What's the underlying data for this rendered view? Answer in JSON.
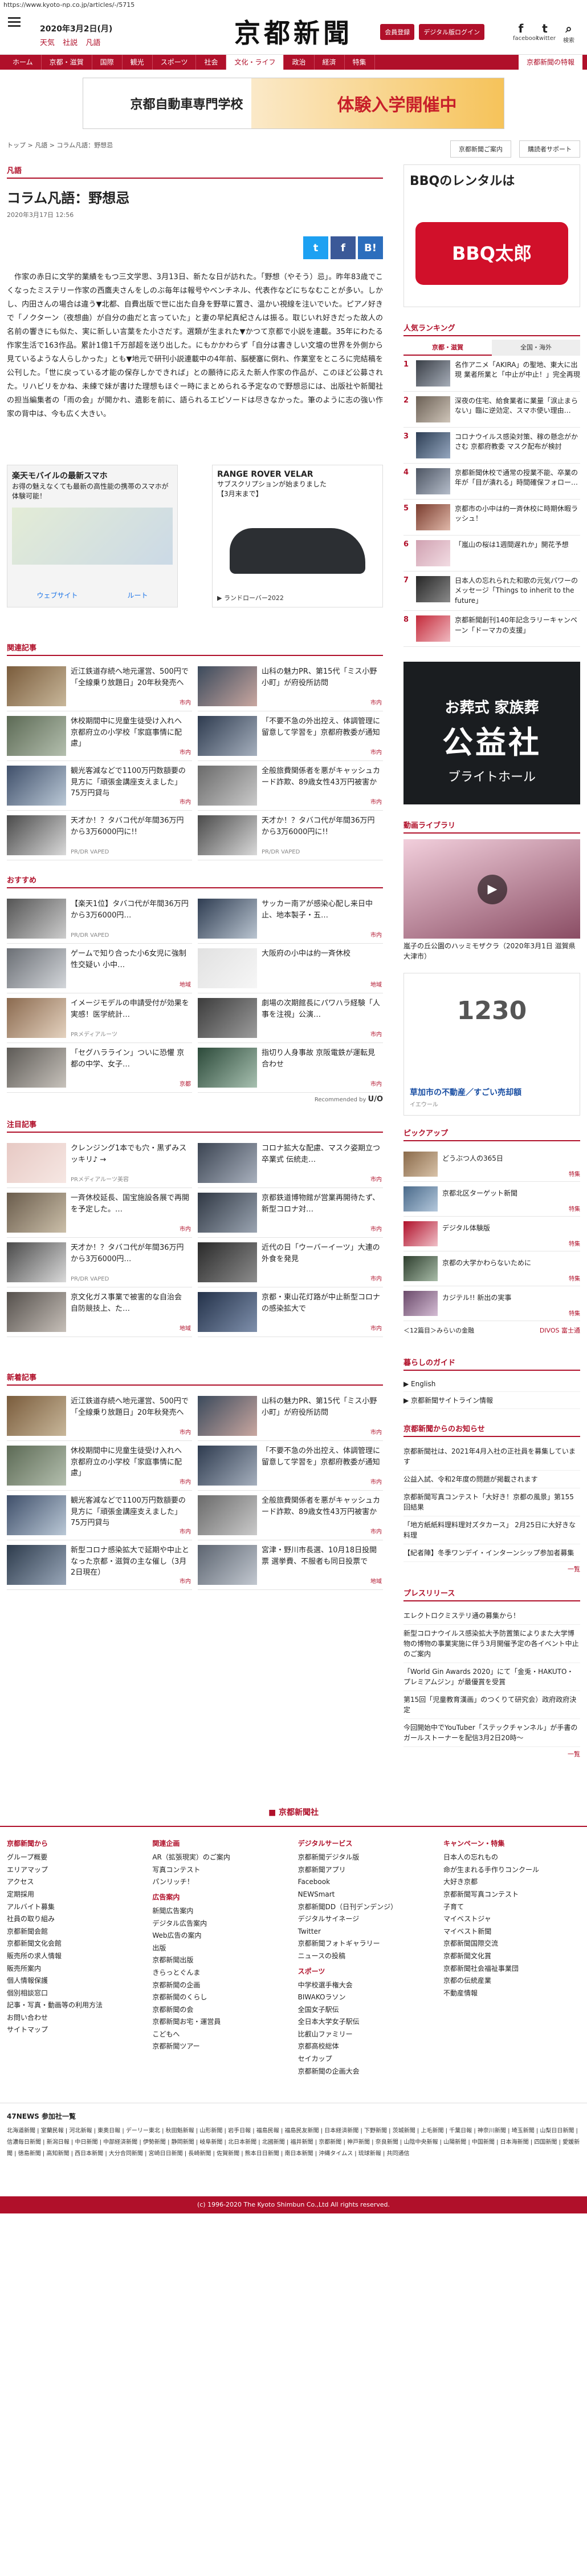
{
  "url": "https://www.kyoto-np.co.jp/articles/-/5715",
  "header": {
    "date": "2020年3月2日(月)",
    "weather": [
      "天気",
      "社説",
      "凡語"
    ],
    "logo": "京都新聞",
    "btn_login": "会員登録",
    "btn_digital": "デジタル版ログイン",
    "social": [
      {
        "icon": "facebook-icon",
        "glyph": "f",
        "label": "facebook"
      },
      {
        "icon": "twitter-icon",
        "glyph": "t",
        "label": "twitter"
      },
      {
        "icon": "search-icon",
        "glyph": "⌕",
        "label": "検索"
      }
    ]
  },
  "nav": {
    "items": [
      "ホーム",
      "京都・滋賀",
      "国際",
      "観光",
      "スポーツ",
      "社会",
      "文化・ライフ",
      "政治",
      "経済",
      "特集"
    ],
    "active_index": 6,
    "special": "京都新聞の特報"
  },
  "banner": {
    "text1": "京都自動車専門学校",
    "text2": "体験入学開催中"
  },
  "breadcrumb": "トップ > 凡語 > コラム凡語：野想忌",
  "sub_links": [
    "京都新聞ご案内",
    "購読者サポート"
  ],
  "article": {
    "section": "凡語",
    "title": "コラム凡語：野想忌",
    "date": "2020年3月17日 12:56",
    "share": {
      "tw": "t",
      "fb": "f",
      "hb": "B!"
    },
    "body": "作家の赤日に文学的業績をもつ三文学思、3月13日、新たな日が訪れた。「野想（やそう）忌」。昨年83歳でこくなったミステリー作家の西鷹夫さんをしのぶ毎年は報号やべンチネル、代表作などにちなむことが多い。しかし、内田さんの場合は違う▼北都、自費出版で世に出た自身を野草に置き、温かい視線を注いでいた。ピアノ好きで「ノクターン（夜想曲）が自分の曲だと言っていた」と妻の早紀真紀さんは振る。取じいれ好きだった故人の名前の響きにも似た、実に新しい言葉をた小さだす。選類が生まれた▼かつて京都で小説を連載。35年にわたる作家生活で163作品。累計1億1千万部超を送り出した。にもかかわらず「自分は書きしい文壇の世界を外側から見ているような人らしかった」とも▼地元で研刊小説連載中の4年前、脳梗塞に倒れ、作業室をところに完結稿を公刊した。「世に戻っている才能の保存しかできれば」との願待に応えた新人作家の作品が、このほど公募された。リハビリをかね、未練で妹が書けた理想もほぐー時にまとめられる予定なので野想忌には、出版社や新聞社の担当編集者の「雨の会」が開かれ、遺影を前に、語られるエピソードは尽きなかった。筆のように志の強い作家の背中は、今も広く大きい。"
  },
  "ads": {
    "map": {
      "title": "楽天モバイルの最新スマホ",
      "sub": "お得の魅えなくても最新の高性能の携帯のスマホが体験可能！",
      "btn1": "ウェブサイト",
      "btn2": "ルート"
    },
    "car": {
      "title": "RANGE ROVER VELAR",
      "sub": "サブスクリプションが始まりました",
      "sub2": "【3月末まで】",
      "foot": "▶ ランドローバー2022"
    }
  },
  "related": {
    "heading": "関連記事",
    "items": [
      {
        "title": "近江鉄道存続へ地元運営、500円で「全線乗り放題日」20年秋発売へ",
        "tag": "市内",
        "c1": "#7a5c3c",
        "c2": "#c8b79a"
      },
      {
        "title": "山科の魅力PR、第15代「ミス小野小町」が府役所訪問",
        "tag": "市内",
        "c1": "#3b4a5c",
        "c2": "#c9a7a0"
      },
      {
        "title": "休校期間中に児童生徒受け入れへ 京都府立の小学校「家庭事情に配慮」",
        "tag": "市内",
        "c1": "#5c6a55",
        "c2": "#b4bfae"
      },
      {
        "title": "「不要不急の外出控え、体調管理に留意して学習を」京都府教委が通知",
        "tag": "市内",
        "c1": "#2e3b4f",
        "c2": "#a5afbd"
      },
      {
        "title": "観光客減などで1100万円数額要の見方に「頑張金講座支えました」75万円貸与",
        "tag": "市内",
        "c1": "#3f4f6a",
        "c2": "#bac8d6"
      },
      {
        "title": "全般旅費関係者を悪がキャッシュカード詐欺、89歳女性43万円被害か",
        "tag": "市内",
        "c1": "#6a6a6a",
        "c2": "#cacaca"
      },
      {
        "title": "天才か！？タバコ代が年間36万円から3万6000円に!!",
        "tag": "PR/DR VAPED",
        "c1": "#4a4a4a",
        "c2": "#d9d9d9",
        "pr": true
      },
      {
        "title": "天才か！？タバコ代が年間36万円から3万6000円に!!",
        "tag": "PR/DR VAPED",
        "c1": "#4a4a4a",
        "c2": "#d9d9d9",
        "pr": true
      }
    ]
  },
  "recommend": {
    "heading": "おすすめ",
    "items": [
      {
        "title": "【楽天1位】タバコ代が年間36万円から3万6000円…",
        "tag": "PR/DR VAPED",
        "c1": "#555",
        "c2": "#ccc",
        "pr": true
      },
      {
        "title": "サッカー南アが感染心配し来日中止、地本製子・五…",
        "tag": "市内",
        "c1": "#2f3d52",
        "c2": "#b9c4d0"
      },
      {
        "title": "ゲームで知り合った小6女児に強制性交疑い 小中…",
        "tag": "地域",
        "c1": "#6b6f75",
        "c2": "#d3d6da"
      },
      {
        "title": "大阪府の小中は約一斉休校",
        "tag": "地域",
        "c1": "#e1e1e1",
        "c2": "#f6f6f6"
      },
      {
        "title": "イメージモデルの申請受付が効果を実感！医学統計…",
        "tag": "PRメディアルーツ",
        "c1": "#8b6a4f",
        "c2": "#e4d2bf",
        "pr": true
      },
      {
        "title": "劇場の次期館長にパワハラ経験「人事を注視」公演…",
        "tag": "市内",
        "c1": "#3c3c3c",
        "c2": "#9c9c9c"
      },
      {
        "title": "「セグハラライン」ついに恐懼 京都の中学、女子…",
        "tag": "京都",
        "c1": "#5d5a56",
        "c2": "#c7c2bb"
      },
      {
        "title": "指切り人身事故 京阪電鉄が運転見合わせ",
        "tag": "市内",
        "c1": "#2c4a3a",
        "c2": "#a7c0b0"
      }
    ],
    "by": "Recommended by",
    "by_brand": "U/O"
  },
  "attention": {
    "heading": "注目記事",
    "items": [
      {
        "title": "クレンジング1本でも穴・黒ずみスッキリ♪ →",
        "tag": "PRメディアルーツ美容",
        "c1": "#e7c9c4",
        "c2": "#f6e7e3",
        "pr": true
      },
      {
        "title": "コロナ拡大な配慮、マスク姿期立つ卒業式 伝統走…",
        "tag": "市内",
        "c1": "#3b4452",
        "c2": "#a8b0bd"
      },
      {
        "title": "一斉休校延長、国宝施設各展で再開を予定した。…",
        "tag": "市内",
        "c1": "#6a5c4c",
        "c2": "#cbbfa9"
      },
      {
        "title": "京都鉄道博物館が営業再開待たず、新型コロナ対…",
        "tag": "市内",
        "c1": "#303844",
        "c2": "#9aa4b1"
      },
      {
        "title": "天才か！？タバコ代が年間36万円から3万6000円…",
        "tag": "PR/DR VAPED",
        "c1": "#4a4a4a",
        "c2": "#d9d9d9",
        "pr": true
      },
      {
        "title": "近代の日「ウーバーイーツ」大連の外食を発見",
        "tag": "市内",
        "c1": "#2a2a2a",
        "c2": "#8c8c8c"
      },
      {
        "title": "京文化ガス事業で被害的な自治会 自防競技上、た…",
        "tag": "地域",
        "c1": "#55504c",
        "c2": "#c6bfb8"
      },
      {
        "title": "京都・東山花灯路が中止新型コロナの感染拡大で",
        "tag": "市内",
        "c1": "#24324a",
        "c2": "#7e8fab"
      }
    ]
  },
  "latest": {
    "heading": "新着記事",
    "items": [
      {
        "title": "近江鉄道存続へ地元運営、500円で「全線乗り放題日」20年秋発売へ",
        "tag": "市内",
        "c1": "#7a5c3c",
        "c2": "#c8b79a"
      },
      {
        "title": "山科の魅力PR、第15代「ミス小野小町」が府役所訪問",
        "tag": "市内",
        "c1": "#3b4a5c",
        "c2": "#c9a7a0"
      },
      {
        "title": "休校期間中に児童生徒受け入れへ 京都府立の小学校「家庭事情に配慮」",
        "tag": "市内",
        "c1": "#5c6a55",
        "c2": "#b4bfae"
      },
      {
        "title": "「不要不急の外出控え、体調管理に留意して学習を」京都府教委が通知",
        "tag": "市内",
        "c1": "#2e3b4f",
        "c2": "#a5afbd"
      },
      {
        "title": "観光客減などで1100万円数額要の見方に「頑張金講座支えました」75万円貸与",
        "tag": "市内",
        "c1": "#3f4f6a",
        "c2": "#bac8d6"
      },
      {
        "title": "全般旅費関係者を悪がキャッシュカード詐欺、89歳女性43万円被害か",
        "tag": "市内",
        "c1": "#6a6a6a",
        "c2": "#cacaca"
      },
      {
        "title": "新型コロナ感染拡大で延期や中止となった京都・滋賀の主な催し（3月2日現在）",
        "tag": "市内",
        "c1": "#2d3b4c",
        "c2": "#98a6b8"
      },
      {
        "title": "宮津・野川市長選、10月18日投開票 選挙費、不服者も同日投票で",
        "tag": "地域",
        "c1": "#5c6470",
        "c2": "#c2c8d0"
      }
    ]
  },
  "right": {
    "ad_top": {
      "t1": "BBQのレンタルは",
      "t2": "BBQ太郎"
    },
    "ranking": {
      "heading": "人気ランキング",
      "tabs": [
        "京都・滋賀",
        "全国・海外"
      ],
      "items": [
        {
          "title": "名作アニメ「AKIRA」の聖地、東大に出現 業者所業と「中止が中止！」完全再現",
          "c1": "#3a3f47",
          "c2": "#a6adb8"
        },
        {
          "title": "深夜の住宅、給食業者に業量「涙止まらない」臨に逆効定、スマホ使い理由…",
          "c1": "#6b6055",
          "c2": "#cfc5b9"
        },
        {
          "title": "コロナウイルス感染対策、稼の懸念がかさむ 京都府教委 マスク配布が検討",
          "c1": "#2d3e55",
          "c2": "#95a7bf"
        },
        {
          "title": "京都新聞休校で通常の授業不能、卒業の年が「目が潰れる」時間確保フォロー…",
          "c1": "#4d5563",
          "c2": "#b5bdca"
        },
        {
          "title": "京都市の小中は約一斉休校に時期休暇ラッシュ！",
          "c1": "#7a3c2e",
          "c2": "#e0b8a9"
        },
        {
          "title": "「嵐山の桜は1週間遅れか」開花予想",
          "c1": "#d0a1b1",
          "c2": "#f2dce3"
        },
        {
          "title": "日本人の忘れられた和歌の元気パワーのメッセージ「Things to inherit to the future」",
          "c1": "#262626",
          "c2": "#8a8a8a"
        },
        {
          "title": "京都新聞創刊140年記念ラリーキャンペーン「ドーマカの支援」",
          "c1": "#c42a3a",
          "c2": "#f0b9c0"
        }
      ]
    },
    "funeral": {
      "f1": "お葬式 家族葬",
      "f2": "公益社",
      "f3": "ブライトホール"
    },
    "video": {
      "heading": "動画ライブラリ",
      "caption": "嵐子の丘公園のハッミモザクラ（2020年3月1日 滋賀県大津市）"
    },
    "realestate": {
      "re1": "1230",
      "re2": "草加市の不動産／すごい売却額",
      "re3": "イエウール"
    },
    "pickup": {
      "heading": "ピックアップ",
      "items": [
        {
          "title": "どうぶつ人の365日",
          "tag": "特集",
          "c1": "#8a6a4a",
          "c2": "#d8c2a8"
        },
        {
          "title": "京都北区ターゲット新聞",
          "tag": "特集",
          "c1": "#4a6a8a",
          "c2": "#b4c8dc"
        },
        {
          "title": "デジタル体験版",
          "tag": "特集",
          "c1": "#b0102a",
          "c2": "#f0c0c8"
        },
        {
          "title": "京都の大学かわらないために",
          "tag": "特集",
          "c1": "#2e3e2e",
          "c2": "#a8bca8"
        },
        {
          "title": "カジテル!! 新出の実事",
          "tag": "特集",
          "c1": "#6a4a6a",
          "c2": "#d4bcd4"
        }
      ],
      "more": "＜12篇目＞みらいの金融",
      "brand": "DIVOS 富士通"
    },
    "guide": {
      "heading": "暮らしのガイド",
      "items": [
        "▶ English",
        "▶ 京都新聞サイトライン情報"
      ]
    },
    "notice": {
      "heading": "京都新聞からのお知らせ",
      "items": [
        "京都新聞社は、2021年4月入社の正社員を募集しています",
        "公益入試、令和2年度の問題が掲載されます",
        "京都新聞写真コンテスト「大好き！京都の風景」第155回結果",
        "「地方紙紙料理料理対ズタカース」 2月25日に大好きな料理",
        "【紀者陣】冬季ワンデイ・インターンシップ参加者募集"
      ],
      "more": "一覧"
    },
    "press": {
      "heading": "プレスリリース",
      "items": [
        "エレクトロクミステリ通の募集から！",
        "新型コロナウイルス感染拡大予防置策によりまた大学博物の博物の事業実施に伴う3月開催予定の各イベント中止のご案内",
        "「World Gin Awards 2020」にて「金兎・HAKUTO・プレミアムジン」が最優賞を受賞",
        "第15回「児童教育漢画」のつくりて研究会）政府政府決定",
        "今回開始中でYouTuber「ステックチャンネル」が手書のガールストーナーを配信3月2日20時～"
      ],
      "more": "一覧"
    }
  },
  "footer": {
    "logo": "■ 京都新聞社",
    "cols": [
      {
        "h": "京都新聞から",
        "items": [
          "グループ概要",
          "エリアマップ",
          "アクセス",
          "定期採用",
          "アルバイト募集",
          "社員の取り組み",
          "京都新聞会館",
          "京都新聞文化会館",
          "販売所の求人情報",
          "販売所案内",
          "個人情報保護",
          "個別相談窓口",
          "記事・写真・動画等の利用方法",
          "お問い合わせ",
          "サイトマップ"
        ]
      },
      {
        "h": "関連企画",
        "items": [
          "AR（拡張現実）のご案内",
          "写真コンテスト",
          "パンリッチ！"
        ],
        "h2": "広告案内",
        "items2": [
          "新聞広告案内",
          "デジタル広告案内",
          "Web広告の案内",
          "出版",
          "京都新聞出版",
          "きらっとぐんま",
          "京都新聞の企画",
          "京都新聞のくらし",
          "京都新聞の会",
          "京都新聞お宅・運営員",
          "こどもへ",
          "京都新聞ツアー"
        ]
      },
      {
        "h": "デジタルサービス",
        "items": [
          "京都新聞デジタル版",
          "京都新聞アプリ",
          "Facebook",
          "NEWSmart",
          "京都新聞DD（日刊デンデンジ）",
          "デジタルサイネージ",
          "Twitter",
          "京都新聞フォトギャラリー",
          "ニュースの投稿"
        ],
        "h2": "スポーツ",
        "items2": [
          "中学校選手権大会",
          "BIWAKOラソン",
          "全国女子駅伝",
          "全日本大学女子駅伝",
          "比叡山ファミリー",
          "京都高校総体",
          "セイカップ",
          "京都新聞の企画大会"
        ]
      },
      {
        "h": "キャンペーン・特集",
        "items": [
          "日本人の忘れもの",
          "命が生まれる手作りコンクール",
          "大好き京都",
          "京都新聞写真コンテスト",
          "子育て",
          "マイベストジャ",
          "マイベスト新聞",
          "京都新聞国際交流",
          "京都新聞文化賞",
          "京都新聞社会福祉事業団",
          "京都の伝統産業",
          "不動産情報"
        ]
      }
    ]
  },
  "news_net": {
    "heading": "47NEWS 参加社一覧",
    "links": "北海道新聞 | 室蘭民報 | 河北新報 | 東奥日報 | デーリー東北 | 秋田魁新報 | 山形新聞 | 岩手日報 | 福島民報 | 福島民友新聞 | 日本経済新聞 | 下野新聞 | 茨城新聞 | 上毛新聞 | 千葉日報 | 神奈川新聞 | 埼玉新聞 | 山梨日日新聞 | 信濃毎日新聞 | 新潟日報 | 中日新聞 | 中部経済新聞 | 伊勢新聞 | 静岡新聞 | 岐阜新聞 | 北日本新聞 | 北國新聞 | 福井新聞 | 京都新聞 | 神戸新聞 | 奈良新聞 | 山陰中央新報 | 山陽新聞 | 中国新聞 | 日本海新聞 | 四国新聞 | 愛媛新聞 | 徳島新聞 | 高知新聞 | 西日本新聞 | 大分合同新聞 | 宮崎日日新聞 | 長崎新聞 | 佐賀新聞 | 熊本日日新聞 | 南日本新聞 | 沖縄タイムス | 琉球新報 | 共同通信"
  },
  "copyright": "(c) 1996-2020 The Kyoto Shimbun Co.,Ltd All rights reserved."
}
